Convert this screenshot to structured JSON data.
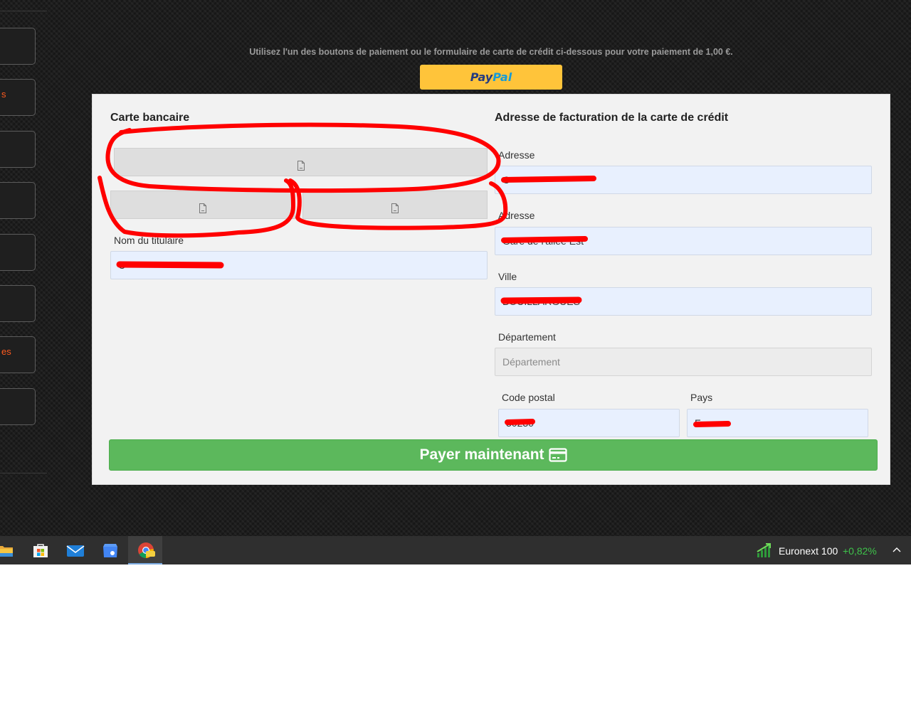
{
  "payment": {
    "instruction": "Utilisez l'un des boutons de paiement ou le formulaire de carte de crédit ci-dessous pour votre paiement de 1,00 €.",
    "paypal": {
      "pay": "Pay",
      "pal": "Pal"
    }
  },
  "sidebar": {
    "items": [
      {
        "label": ""
      },
      {
        "label": "s"
      },
      {
        "label": ""
      },
      {
        "label": ""
      },
      {
        "label": ""
      },
      {
        "label": ""
      },
      {
        "label": "es"
      },
      {
        "label": ""
      }
    ]
  },
  "card": {
    "title": "Carte bancaire",
    "holder_label": "Nom du titulaire",
    "holder_value": "C"
  },
  "billing": {
    "title": "Adresse de facturation de la carte de crédit",
    "address1_label": "Adresse",
    "address1_value": "C",
    "address2_label": "Adresse",
    "address2_value": "Gare de l'allée Est",
    "city_label": "Ville",
    "city_value": "BOUILLARGUES",
    "state_label": "Département",
    "state_placeholder": "Département",
    "zip_label": "Code postal",
    "zip_value": "30230",
    "country_label": "Pays",
    "country_value": "F"
  },
  "submit": {
    "label": "Payer maintenant"
  },
  "taskbar": {
    "stock_name": "Euronext 100",
    "stock_change": "+0,82%"
  },
  "colors": {
    "pay_button": "#5cb85c",
    "paypal_button": "#ffc43a",
    "annotation": "#ff0000",
    "stock_positive": "#3ec24a"
  }
}
